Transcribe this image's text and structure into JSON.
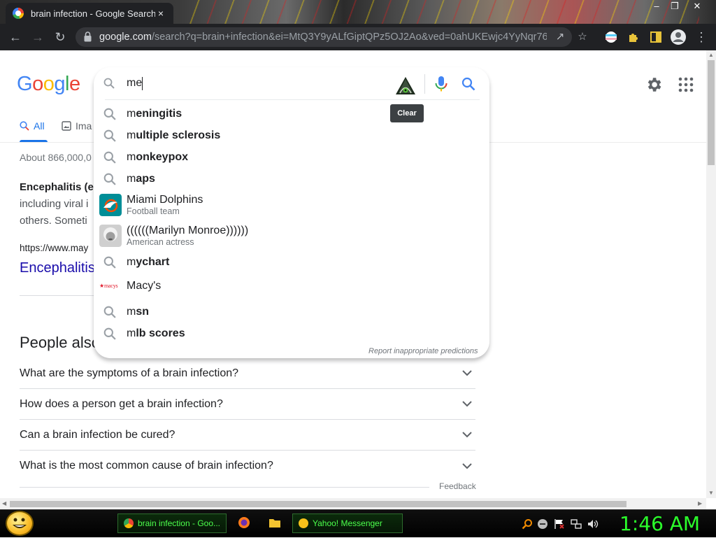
{
  "browser": {
    "tab_title": "brain infection - Google Search",
    "tab_close": "×",
    "url_host": "google.com",
    "url_rest": "/search?q=brain+infection&ei=MtQ3Y9yALfGiptQPz5OJ2Ao&ved=0ahUKEwjc4YyNqr76A...",
    "window_buttons": [
      "–",
      "❐",
      "✕"
    ]
  },
  "google": {
    "logo_letters": [
      "G",
      "o",
      "o",
      "g",
      "l",
      "e"
    ],
    "logo_colors": [
      "#4285f4",
      "#ea4335",
      "#fbbc05",
      "#4285f4",
      "#34a853",
      "#ea4335"
    ],
    "tabs": {
      "all": "All",
      "images": "Ima"
    },
    "stats": "About 866,000,0",
    "snippet_bold": "Encephalitis (e",
    "snippet_line2": "including viral i",
    "snippet_line3": "others. Someti",
    "cite": "https://www.may",
    "result_title": "Encephalitis",
    "paa_heading": "People also",
    "paa_questions": [
      "What are the symptoms of a brain infection?",
      "How does a person get a brain infection?",
      "Can a brain infection be cured?",
      "What is the most common cause of brain infection?"
    ],
    "feedback": "Feedback"
  },
  "search": {
    "query": "me",
    "clear_tooltip": "Clear",
    "report": "Report inappropriate predictions",
    "suggestions": [
      {
        "prefix": "m",
        "rest": "eningitis",
        "prefix_bold": false,
        "rest_bold": true
      },
      {
        "prefix": "m",
        "rest": "ultiple sclerosis",
        "prefix_bold": false,
        "rest_bold": true
      },
      {
        "prefix": "m",
        "rest": "onkeypox",
        "prefix_bold": false,
        "rest_bold": true
      },
      {
        "prefix": "m",
        "rest": "aps",
        "prefix_bold": false,
        "rest_bold": true
      },
      {
        "title": "Miami Dolphins",
        "subtitle": "Football team"
      },
      {
        "title": "((((((Marilyn Monroe))))))",
        "subtitle": "American actress"
      },
      {
        "prefix": "m",
        "rest": "ychart",
        "prefix_bold": false,
        "rest_bold": true
      },
      {
        "title": "Macy's",
        "logo_text": "★macys"
      },
      {
        "prefix": "m",
        "rest": "sn",
        "prefix_bold": false,
        "rest_bold": true
      },
      {
        "prefix": "m",
        "rest": "lb scores",
        "prefix_bold": false,
        "rest_bold": true
      }
    ]
  },
  "taskbar": {
    "tasks": [
      "brain infection - Goo...",
      "Yahoo! Messenger"
    ],
    "clock": "1:46 AM"
  }
}
